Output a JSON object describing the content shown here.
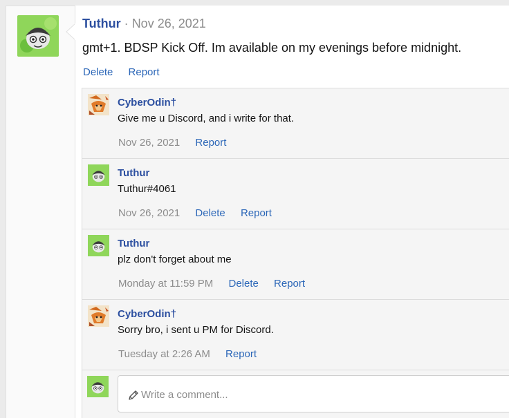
{
  "post": {
    "author": "Tuthur",
    "separator": "·",
    "date": "Nov 26, 2021",
    "body": "gmt+1. BDSP Kick Off. Im available on my evenings before midnight.",
    "actions": {
      "delete": "Delete",
      "report": "Report"
    }
  },
  "comments": [
    {
      "author": "CyberOdin†",
      "avatar": "fox-avatar",
      "text": "Give me u Discord, and i write for that.",
      "date": "Nov 26, 2021",
      "delete": null,
      "report": "Report"
    },
    {
      "author": "Tuthur",
      "avatar": "frog-avatar",
      "text": "Tuthur#4061",
      "date": "Nov 26, 2021",
      "delete": "Delete",
      "report": "Report"
    },
    {
      "author": "Tuthur",
      "avatar": "frog-avatar",
      "text": "plz don't forget about me",
      "date": "Monday at 11:59 PM",
      "delete": "Delete",
      "report": "Report"
    },
    {
      "author": "CyberOdin†",
      "avatar": "fox-avatar",
      "text": "Sorry bro, i sent u PM for Discord.",
      "date": "Tuesday at 2:26 AM",
      "delete": null,
      "report": "Report"
    }
  ],
  "composer": {
    "placeholder": "Write a comment...",
    "icon": "pencil-icon"
  },
  "colors": {
    "username": "#2c4fa0",
    "link": "#2c67b8",
    "muted": "#8c8c8c",
    "avatar_green": "#7ec850"
  }
}
